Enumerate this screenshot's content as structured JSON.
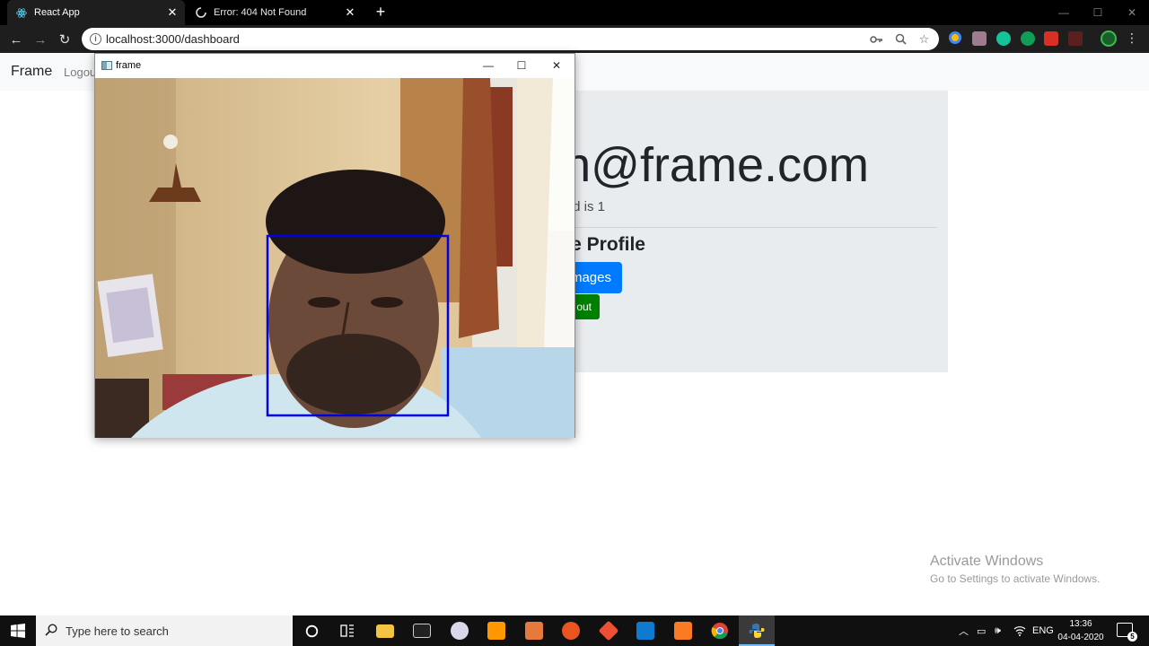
{
  "browser": {
    "tabs": [
      {
        "title": "React App",
        "active": true
      },
      {
        "title": "Error: 404 Not Found",
        "active": false
      }
    ],
    "new_tab": "+",
    "url": "localhost:3000/dashboard"
  },
  "page": {
    "brand": "Frame",
    "nav_link": "Logout",
    "heading": "in@frame.com",
    "lead": "d is 1",
    "subheading": "e Profile",
    "primary_button": "mages",
    "green_button": "out"
  },
  "cv_window": {
    "title": "frame"
  },
  "watermark": {
    "line1": "Activate Windows",
    "line2": "Go to Settings to activate Windows."
  },
  "taskbar": {
    "search_placeholder": "Type here to search",
    "language": "ENG",
    "time": "13:36",
    "date": "04-04-2020",
    "notification_count": "5"
  },
  "colors": {
    "primary": "#007bff",
    "success": "#008000",
    "jumbotron": "#e9ecef",
    "face_box": "#0000e0"
  }
}
